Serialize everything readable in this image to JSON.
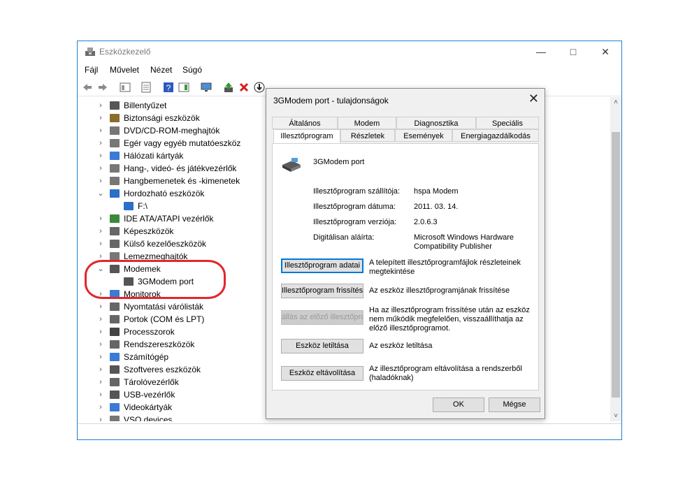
{
  "window": {
    "title": "Eszközkezelő",
    "min_icon": "minimize-icon",
    "max_icon": "maximize-icon",
    "close_icon": "close-icon"
  },
  "menu": [
    "Fájl",
    "Művelet",
    "Nézet",
    "Súgó"
  ],
  "tree": {
    "items": [
      {
        "label": "Billentyűzet",
        "expanded": false
      },
      {
        "label": "Biztonsági eszközök",
        "expanded": false
      },
      {
        "label": "DVD/CD-ROM-meghajtók",
        "expanded": false
      },
      {
        "label": "Egér vagy egyéb mutatóeszköz",
        "expanded": false
      },
      {
        "label": "Hálózati kártyák",
        "expanded": false
      },
      {
        "label": "Hang-, videó- és játékvezérlők",
        "expanded": false
      },
      {
        "label": "Hangbemenetek és -kimenetek",
        "expanded": false
      },
      {
        "label": "Hordozható eszközök",
        "expanded": true
      },
      {
        "label": "F:\\",
        "child": true
      },
      {
        "label": "IDE ATA/ATAPI vezérlők",
        "expanded": false
      },
      {
        "label": "Képeszközök",
        "expanded": false
      },
      {
        "label": "Külső kezelőeszközök",
        "expanded": false
      },
      {
        "label": "Lemezmeghajtók",
        "expanded": false
      },
      {
        "label": "Modemek",
        "expanded": true
      },
      {
        "label": "3GModem port",
        "child": true
      },
      {
        "label": "Monitorok",
        "expanded": false
      },
      {
        "label": "Nyomtatási várólisták",
        "expanded": false
      },
      {
        "label": "Portok (COM és LPT)",
        "expanded": false
      },
      {
        "label": "Processzorok",
        "expanded": false
      },
      {
        "label": "Rendszereszközök",
        "expanded": false
      },
      {
        "label": "Számítógép",
        "expanded": false
      },
      {
        "label": "Szoftveres eszközök",
        "expanded": false
      },
      {
        "label": "Tárolóvezérlők",
        "expanded": false
      },
      {
        "label": "USB-vezérlők",
        "expanded": false
      },
      {
        "label": "Videokártyák",
        "expanded": false
      },
      {
        "label": "VSO devices",
        "expanded": false
      }
    ]
  },
  "dialog": {
    "title": "3GModem port - tulajdonságok",
    "tabs_row1": [
      "Általános",
      "Modem",
      "Diagnosztika",
      "Speciális"
    ],
    "tabs_row2": [
      "Illesztőprogram",
      "Részletek",
      "Események",
      "Energiagazdálkodás"
    ],
    "device_name": "3GModem port",
    "props": [
      {
        "label": "Illesztőprogram szállítója:",
        "value": "hspa Modem"
      },
      {
        "label": "Illesztőprogram dátuma:",
        "value": "2011. 03. 14."
      },
      {
        "label": "Illesztőprogram verziója:",
        "value": "2.0.6.3"
      },
      {
        "label": "Digitálisan aláírta:",
        "value": "Microsoft Windows Hardware Compatibility Publisher"
      }
    ],
    "actions": [
      {
        "button": "Illesztőprogram adatai",
        "desc": "A telepített illesztőprogramfájlok részleteinek megtekintése"
      },
      {
        "button": "Illesztőprogram frissítése",
        "desc": "Az eszköz illesztőprogramjának frissítése"
      },
      {
        "button": "állás az előző illesztőprog",
        "desc": "Ha az illesztőprogram frissítése után az eszköz nem működik megfelelően, visszaállíthatja az előző illesztőprogramot."
      },
      {
        "button": "Eszköz letiltása",
        "desc": "Az eszköz letiltása"
      },
      {
        "button": "Eszköz eltávolítása",
        "desc": "Az illesztőprogram eltávolítása a rendszerből (haladóknak)"
      }
    ],
    "ok_label": "OK",
    "cancel_label": "Mégse",
    "close_label": "✕"
  },
  "colors": {
    "accent": "#0078d7",
    "highlight_oval": "#e3262c",
    "window_border": "#1e7fd6"
  }
}
